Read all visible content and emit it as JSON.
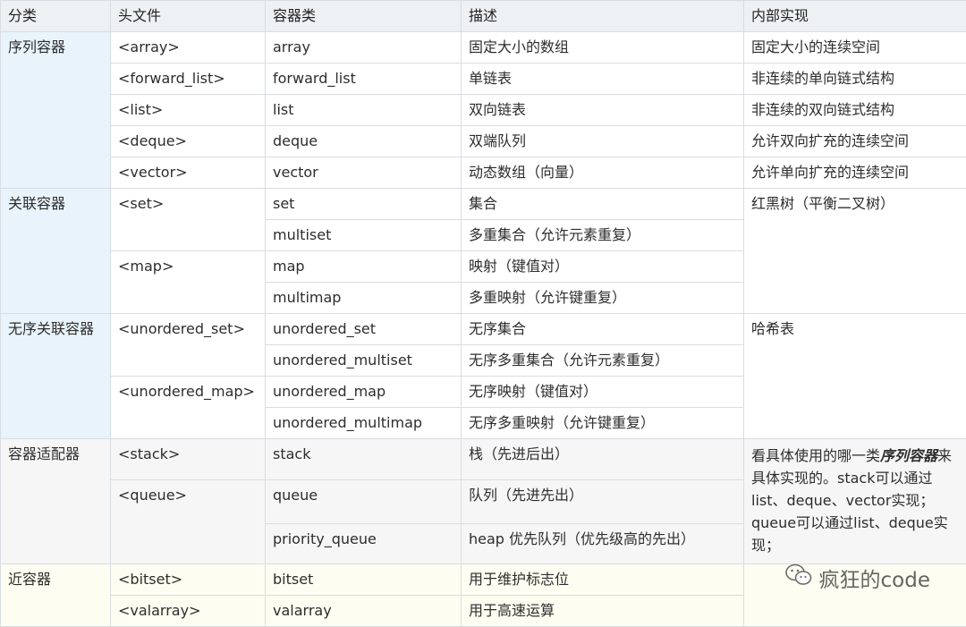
{
  "columns": [
    "分类",
    "头文件",
    "容器类",
    "描述",
    "内部实现"
  ],
  "seq": {
    "category": "序列容器",
    "rows": [
      {
        "header": "<array>",
        "cls": "array",
        "desc": "固定大小的数组",
        "impl": "固定大小的连续空间"
      },
      {
        "header": "<forward_list>",
        "cls": "forward_list",
        "desc": "单链表",
        "impl": "非连续的单向链式结构"
      },
      {
        "header": "<list>",
        "cls": "list",
        "desc": "双向链表",
        "impl": "非连续的双向链式结构"
      },
      {
        "header": "<deque>",
        "cls": "deque",
        "desc": "双端队列",
        "impl": "允许双向扩充的连续空间"
      },
      {
        "header": "<vector>",
        "cls": "vector",
        "desc": "动态数组（向量）",
        "impl": "允许单向扩充的连续空间"
      }
    ]
  },
  "assoc": {
    "category": "关联容器",
    "header_set": "<set>",
    "header_map": "<map>",
    "impl": "红黑树（平衡二叉树）",
    "rows": [
      {
        "cls": "set",
        "desc": "集合"
      },
      {
        "cls": "multiset",
        "desc": "多重集合（允许元素重复）"
      },
      {
        "cls": "map",
        "desc": "映射（键值对）"
      },
      {
        "cls": "multimap",
        "desc": "多重映射（允许键重复）"
      }
    ]
  },
  "unordered": {
    "category": "无序关联容器",
    "header_set": "<unordered_set>",
    "header_map": "<unordered_map>",
    "impl": "哈希表",
    "rows": [
      {
        "cls": "unordered_set",
        "desc": "无序集合"
      },
      {
        "cls": "unordered_multiset",
        "desc": "无序多重集合（允许元素重复）"
      },
      {
        "cls": "unordered_map",
        "desc": "无序映射（键值对）"
      },
      {
        "cls": "unordered_multimap",
        "desc": "无序多重映射（允许键重复）"
      }
    ]
  },
  "adapter": {
    "category": "容器适配器",
    "header_stack": "<stack>",
    "header_queue": "<queue>",
    "impl_before": "看具体使用的哪一类",
    "impl_emph": "序列容器",
    "impl_after": "来具体实现的。stack可以通过list、deque、vector实现；queue可以通过list、deque实现；",
    "rows": [
      {
        "cls": "stack",
        "desc": "栈（先进后出）"
      },
      {
        "cls": "queue",
        "desc": "队列（先进先出）"
      },
      {
        "cls": "priority_queue",
        "desc": "heap 优先队列（优先级高的先出）"
      }
    ]
  },
  "near": {
    "category": "近容器",
    "rows": [
      {
        "header": "<bitset>",
        "cls": "bitset",
        "desc": "用于维护标志位"
      },
      {
        "header": "<valarray>",
        "cls": "valarray",
        "desc": "用于高速运算"
      }
    ]
  },
  "watermark": {
    "text": "疯狂的code",
    "icon": "wechat-icon"
  }
}
